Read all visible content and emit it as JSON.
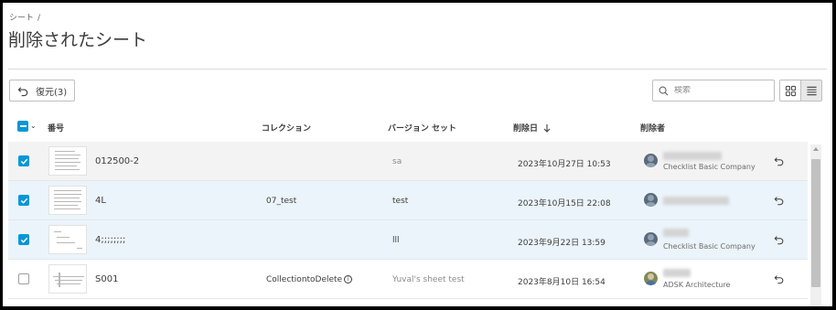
{
  "breadcrumb": {
    "root": "シート",
    "separator": "/"
  },
  "page_title": "削除されたシート",
  "toolbar": {
    "restore_label": "復元(3)",
    "search_placeholder": "検索"
  },
  "columns": {
    "number": "番号",
    "collection": "コレクション",
    "version_set": "バージョン セット",
    "deleted_date": "削除日",
    "deleted_by": "削除者"
  },
  "icons": {
    "restore": "undo-arrow-icon",
    "search": "search-icon",
    "grid_view": "grid-view-icon",
    "list_view": "list-view-icon",
    "sort": "arrow-down-icon",
    "info": "info-icon"
  },
  "colors": {
    "accent": "#0696d7",
    "selected_row": "#ebf4fa"
  },
  "rows": [
    {
      "checked": true,
      "number": "012500-2",
      "collection": "",
      "version_set": "sa",
      "version_muted": true,
      "deleted_date": "2023年10月27日 10:53",
      "company": "Checklist Basic Company"
    },
    {
      "checked": true,
      "number": "4L",
      "collection": "07_test",
      "version_set": "test",
      "version_muted": false,
      "deleted_date": "2023年10月15日 22:08",
      "company": ""
    },
    {
      "checked": true,
      "number": "4;;;;;;;;",
      "collection": "",
      "version_set": "lll",
      "version_muted": false,
      "deleted_date": "2023年9月22日 13:59",
      "company": "Checklist Basic Company"
    },
    {
      "checked": false,
      "number": "S001",
      "collection": "CollectiontoDelete",
      "version_set": "Yuval's sheet test",
      "version_muted": true,
      "deleted_date": "2023年8月10日 16:54",
      "company": "ADSK Architecture"
    }
  ]
}
